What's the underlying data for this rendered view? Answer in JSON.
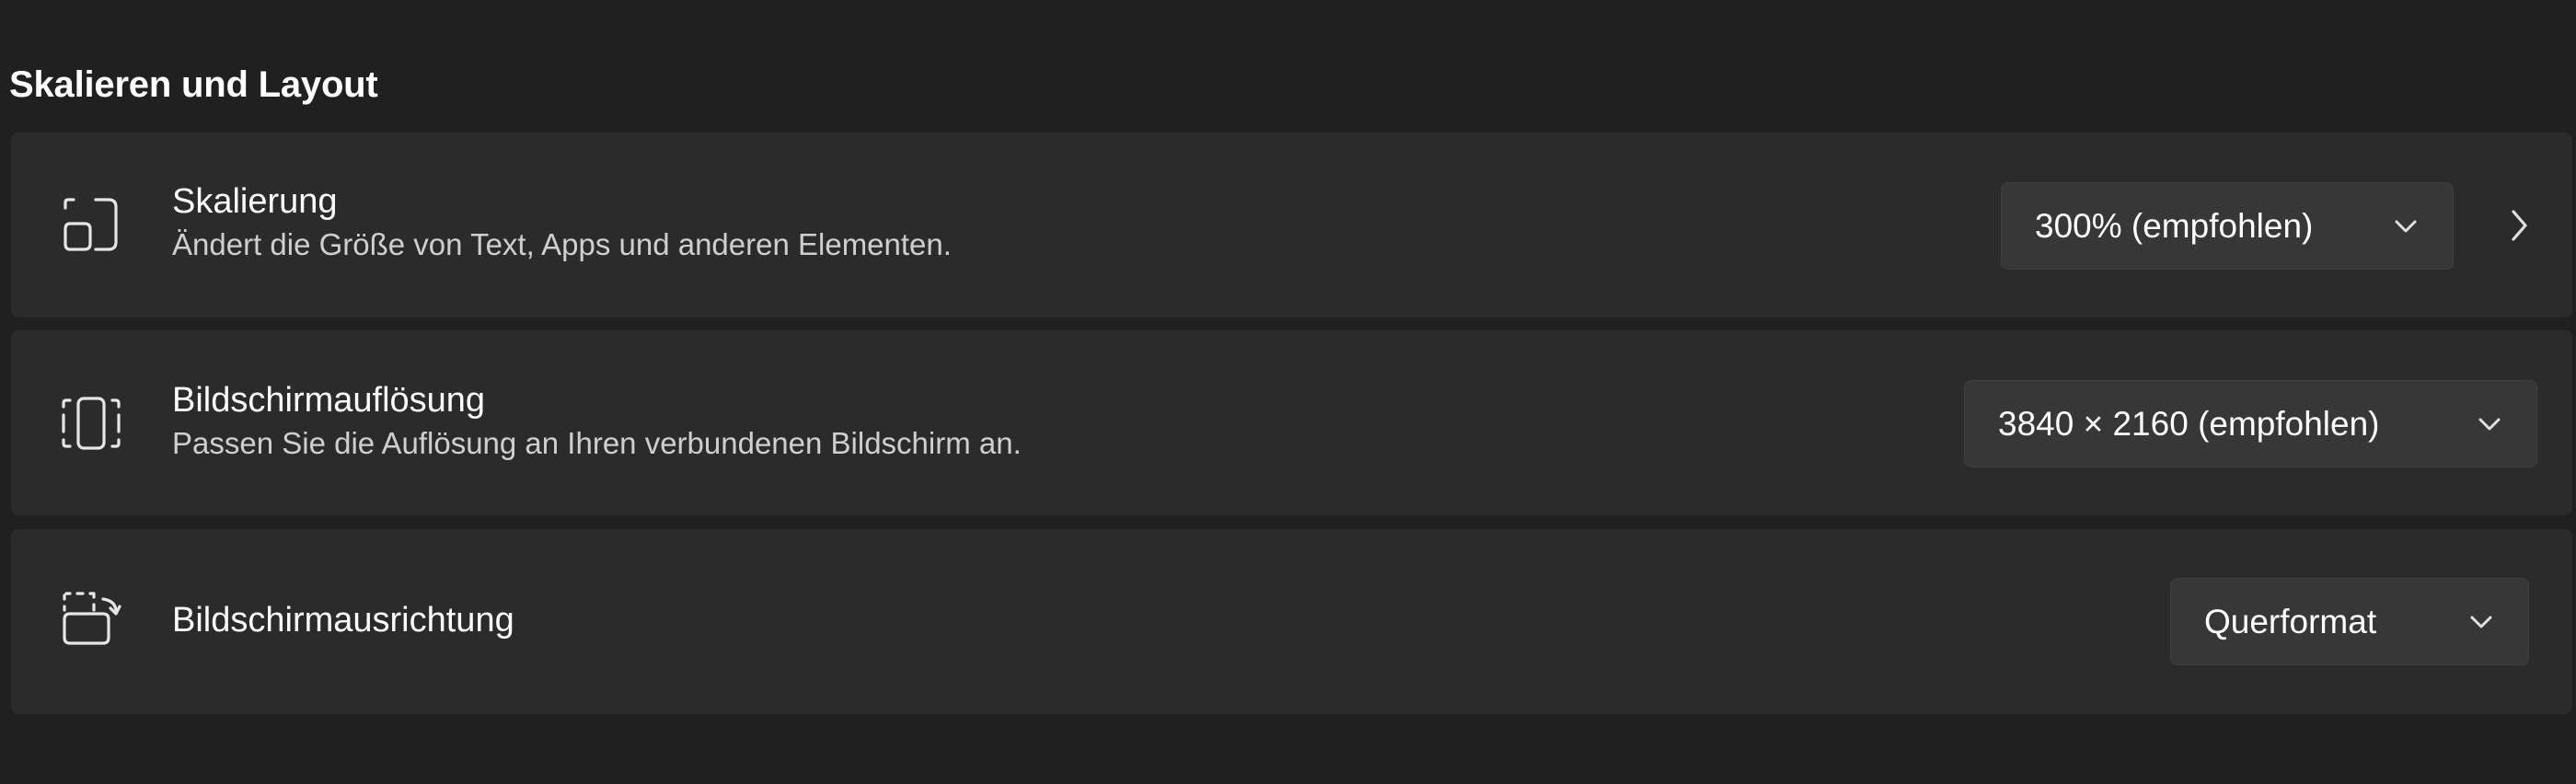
{
  "section": {
    "title": "Skalieren und Layout"
  },
  "settings": [
    {
      "title": "Skalierung",
      "description": "Ändert die Größe von Text, Apps und anderen Elementen.",
      "icon": "scale-icon",
      "dropdown_value": "300% (empfohlen)",
      "has_chevron_right": true
    },
    {
      "title": "Bildschirmauflösung",
      "description": "Passen Sie die Auflösung an Ihren verbundenen Bildschirm an.",
      "icon": "resolution-icon",
      "dropdown_value": "3840 × 2160 (empfohlen)"
    },
    {
      "title": "Bildschirmausrichtung",
      "icon": "orientation-icon",
      "dropdown_value": "Querformat"
    }
  ],
  "colors": {
    "background": "#202020",
    "card": "#2b2b2b",
    "dropdown": "#373737",
    "text_primary": "#ffffff",
    "text_secondary": "#cfcfcf"
  }
}
